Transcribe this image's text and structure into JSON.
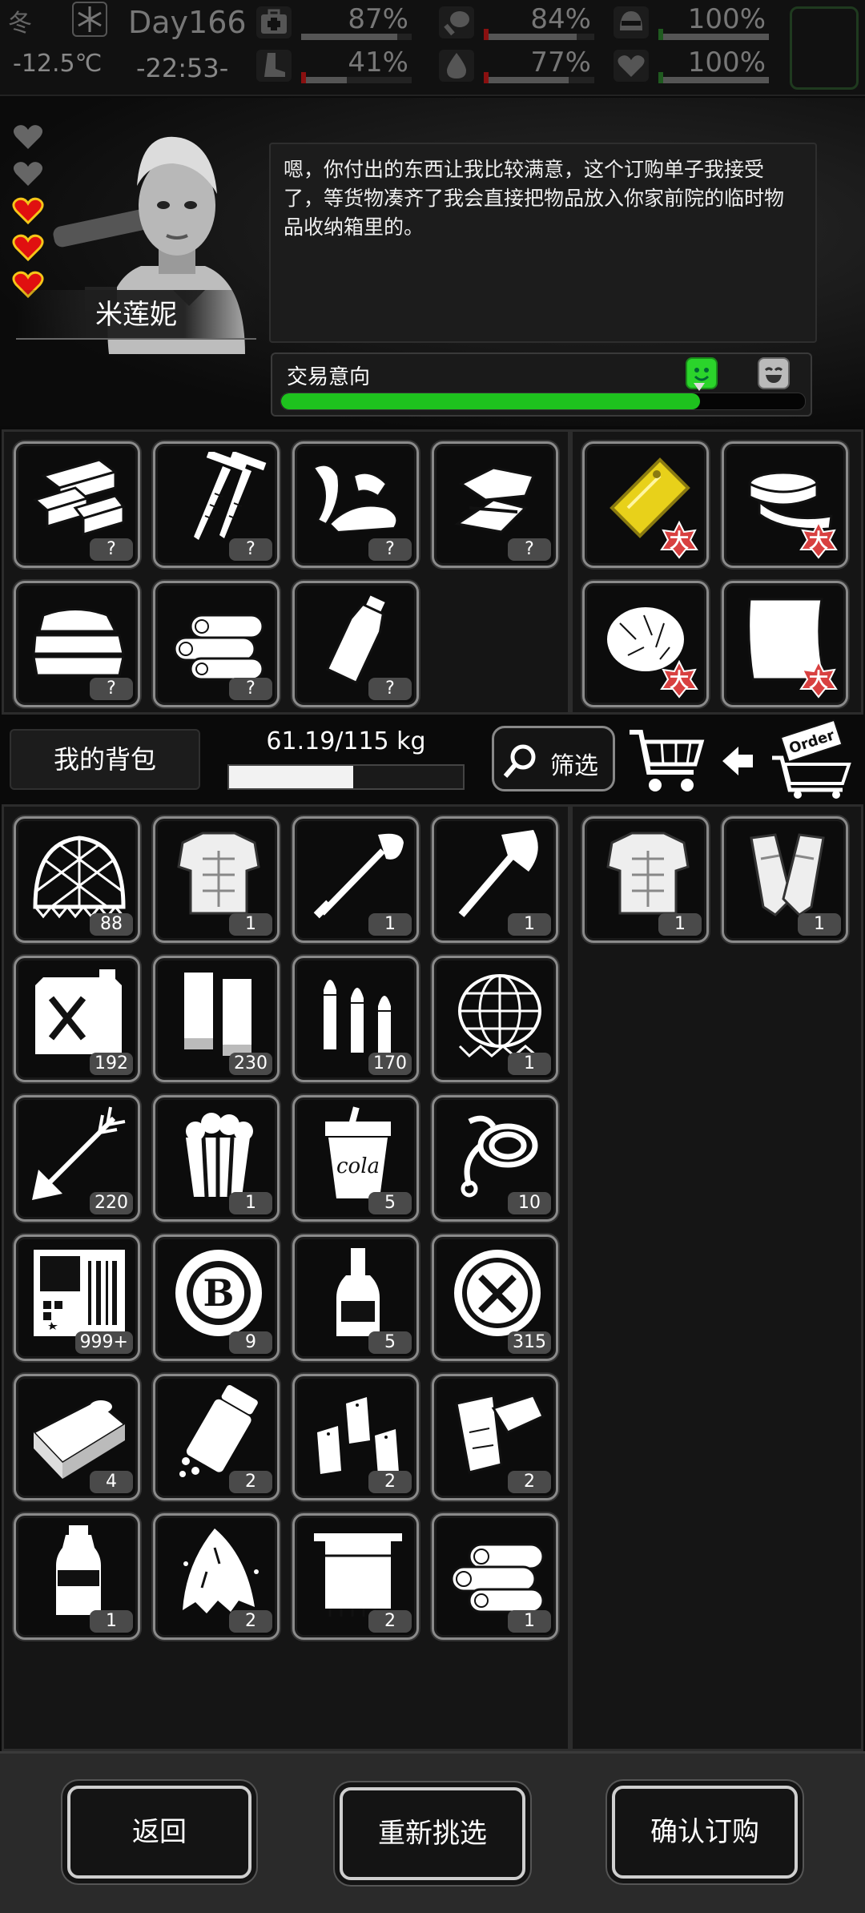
{
  "status": {
    "season": "冬",
    "temperature": "-12.5℃",
    "day": "Day166",
    "time": "-22:53-",
    "stats": [
      {
        "name": "health",
        "icon": "medkit-icon",
        "value": "87%",
        "fraction": 0.87
      },
      {
        "name": "food",
        "icon": "chicken-leg-icon",
        "value": "84%",
        "fraction": 0.84
      },
      {
        "name": "armor",
        "icon": "helmet-icon",
        "value": "100%",
        "fraction": 1.0
      },
      {
        "name": "stamina",
        "icon": "boot-icon",
        "value": "41%",
        "fraction": 0.41
      },
      {
        "name": "water",
        "icon": "water-drop-icon",
        "value": "77%",
        "fraction": 0.77
      },
      {
        "name": "mood",
        "icon": "heart-icon",
        "value": "100%",
        "fraction": 1.0
      }
    ]
  },
  "npc": {
    "name": "米莲妮",
    "hearts_filled": 3,
    "hearts_total": 5,
    "dialog": "嗯，你付出的东西让我比较满意，这个订购单子我接受了，等货物凑齐了我会直接把物品放入你家前院的临时物品收纳箱里的。",
    "trade_label": "交易意向",
    "trade_level": 0.8
  },
  "npc_offer_items": [
    {
      "icon": "wood-planks-icon",
      "qty": "?"
    },
    {
      "icon": "nails-icon",
      "qty": "?"
    },
    {
      "icon": "cloth-scraps-icon",
      "qty": "?"
    },
    {
      "icon": "metal-scrap-icon",
      "qty": "?"
    },
    {
      "icon": "folded-cloth-icon",
      "qty": "?"
    },
    {
      "icon": "logs-icon",
      "qty": "?"
    },
    {
      "icon": "bottle-icon",
      "qty": "?"
    }
  ],
  "npc_request_items": [
    {
      "icon": "gold-plate-icon",
      "badge": "大"
    },
    {
      "icon": "tape-roll-icon",
      "badge": "大"
    },
    {
      "icon": "fur-icon",
      "badge": "大"
    },
    {
      "icon": "paper-sheet-icon",
      "badge": "大"
    }
  ],
  "bag": {
    "tab_label": "我的背包",
    "weight_text": "61.19/115 kg",
    "weight_fraction": 0.532,
    "filter_label": "筛选",
    "order_label": "Order"
  },
  "backpack_items": [
    {
      "icon": "net-icon",
      "qty": "88"
    },
    {
      "icon": "body-armor-icon",
      "qty": "1"
    },
    {
      "icon": "shovel-icon",
      "qty": "1"
    },
    {
      "icon": "axe-icon",
      "qty": "1"
    },
    {
      "icon": "fuel-can-icon",
      "qty": "192"
    },
    {
      "icon": "shotgun-shells-icon",
      "qty": "230"
    },
    {
      "icon": "bullets-icon",
      "qty": "170"
    },
    {
      "icon": "globe-net-icon",
      "qty": "1"
    },
    {
      "icon": "arrow-icon",
      "qty": "220"
    },
    {
      "icon": "popcorn-icon",
      "qty": "1"
    },
    {
      "icon": "cola-cup-icon",
      "qty": "5",
      "text": "cola"
    },
    {
      "icon": "rope-icon",
      "qty": "10"
    },
    {
      "icon": "lottery-card-icon",
      "qty": "999+"
    },
    {
      "icon": "bitcoin-chip-icon",
      "qty": "9"
    },
    {
      "icon": "liquor-bottle-icon",
      "qty": "5"
    },
    {
      "icon": "tool-badge-icon",
      "qty": "315"
    },
    {
      "icon": "canned-food-icon",
      "qty": "4"
    },
    {
      "icon": "pill-bottle-icon",
      "qty": "2"
    },
    {
      "icon": "salt-shakers-icon",
      "qty": "2"
    },
    {
      "icon": "leather-pieces-icon",
      "qty": "2"
    },
    {
      "icon": "water-bottle-icon",
      "qty": "1"
    },
    {
      "icon": "torn-cloth-icon",
      "qty": "2"
    },
    {
      "icon": "towel-icon",
      "qty": "2"
    },
    {
      "icon": "logs-icon",
      "qty": "1"
    }
  ],
  "selected_items": [
    {
      "icon": "body-armor-icon",
      "qty": "1"
    },
    {
      "icon": "leg-guards-icon",
      "qty": "1"
    }
  ],
  "buttons": {
    "back": "返回",
    "reselect": "重新挑选",
    "confirm": "确认订购"
  },
  "colors": {
    "trade_green": "#1ec21e",
    "heart_red": "#e01010",
    "badge_red": "#d84040"
  }
}
